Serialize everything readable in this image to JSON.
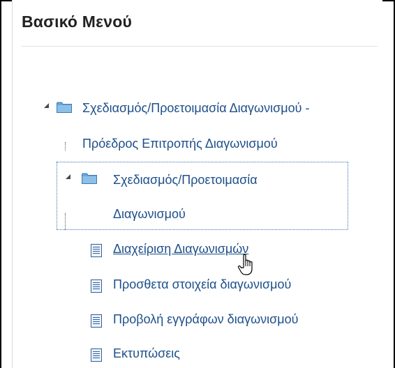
{
  "menu": {
    "title": "Βασικό Μενού",
    "tree": {
      "root": {
        "label_line1": "Σχεδιασμός/Προετοιμασία Διαγωνισμού -",
        "label_line2": "Πρόεδρος Επιτροπής Διαγωνισμού",
        "expanded": true,
        "icon": "folder-icon"
      },
      "child": {
        "label_line1": "Σχεδιασμός/Προετοιμασία",
        "label_line2": "Διαγωνισμού",
        "expanded": true,
        "icon": "folder-icon"
      },
      "leaves": [
        {
          "label": "Διαχείριση Διαγωνισμών",
          "icon": "page-icon",
          "hovered": true
        },
        {
          "label": "Προσθετα στοιχεία διαγωνισμού",
          "icon": "page-icon"
        },
        {
          "label": "Προβολή εγγράφων διαγωνισμού",
          "icon": "page-icon"
        },
        {
          "label": "Εκτυπώσεις",
          "icon": "page-icon"
        }
      ]
    }
  },
  "colors": {
    "link": "#1d4f8a",
    "title": "#222222",
    "folder": "#6aa6d8",
    "focus": "#3a6fb4"
  }
}
